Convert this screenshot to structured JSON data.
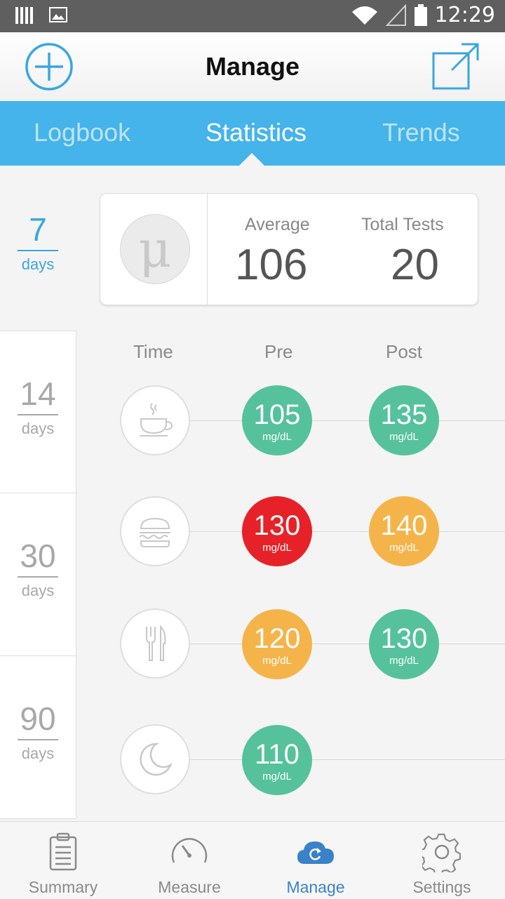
{
  "status_bar": {
    "time": "12:29"
  },
  "header": {
    "title": "Manage",
    "add_icon": "plus-circle-icon",
    "export_icon": "external-link-icon"
  },
  "tabs": [
    {
      "label": "Logbook",
      "active": false
    },
    {
      "label": "Statistics",
      "active": true
    },
    {
      "label": "Trends",
      "active": false
    }
  ],
  "periods": [
    {
      "num": "7",
      "unit": "days",
      "selected": true
    },
    {
      "num": "14",
      "unit": "days",
      "selected": false
    },
    {
      "num": "30",
      "unit": "days",
      "selected": false
    },
    {
      "num": "90",
      "unit": "days",
      "selected": false
    }
  ],
  "summary": {
    "symbol": "μ",
    "average_label": "Average",
    "average_value": "106",
    "tests_label": "Total Tests",
    "tests_value": "20"
  },
  "table": {
    "headers": {
      "time": "Time",
      "pre": "Pre",
      "post": "Post"
    },
    "unit": "mg/dL",
    "rows": [
      {
        "icon": "coffee-cup-icon",
        "pre": "105",
        "pre_color": "#55c29c",
        "post": "135",
        "post_color": "#55c29c"
      },
      {
        "icon": "burger-icon",
        "pre": "130",
        "pre_color": "#e62228",
        "post": "140",
        "post_color": "#f5b44a"
      },
      {
        "icon": "fork-knife-icon",
        "pre": "120",
        "pre_color": "#f5b44a",
        "post": "130",
        "post_color": "#55c29c"
      },
      {
        "icon": "moon-icon",
        "pre": "110",
        "pre_color": "#55c29c",
        "post": null,
        "post_color": null
      }
    ]
  },
  "nav": [
    {
      "label": "Summary",
      "icon": "clipboard-icon",
      "active": false
    },
    {
      "label": "Measure",
      "icon": "gauge-icon",
      "active": false
    },
    {
      "label": "Manage",
      "icon": "cloud-sync-icon",
      "active": true
    },
    {
      "label": "Settings",
      "icon": "gear-icon",
      "active": false
    }
  ],
  "colors": {
    "accent": "#44b4ea",
    "green": "#55c29c",
    "red": "#e62228",
    "orange": "#f5b44a",
    "nav_active": "#3a82c8"
  }
}
